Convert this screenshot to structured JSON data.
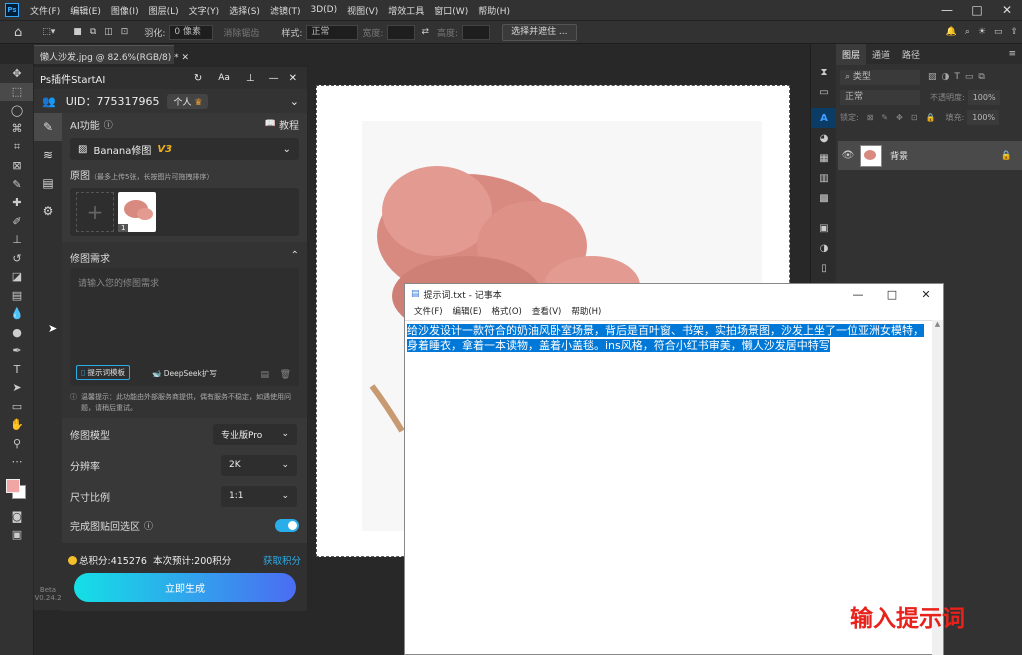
{
  "menubar": {
    "items": [
      "文件(F)",
      "编辑(E)",
      "图像(I)",
      "图层(L)",
      "文字(Y)",
      "选择(S)",
      "滤镜(T)",
      "3D(D)",
      "视图(V)",
      "增效工具",
      "窗口(W)",
      "帮助(H)"
    ]
  },
  "options": {
    "feather_label": "羽化:",
    "feather_value": "0 像素",
    "antialias": "消除锯齿",
    "style_label": "样式:",
    "style_value": "正常",
    "width_label": "宽度:",
    "height_label": "高度:",
    "select_mask": "选择并遮住 ..."
  },
  "document": {
    "tab": "懒人沙发.jpg @ 82.6%(RGB/8) *"
  },
  "plugin": {
    "title": "Ps插件StartAI",
    "uid": "UID：775317965",
    "account": "个人",
    "ai_label": "AI功能",
    "tutorial": "教程",
    "model_select": "Banana修图",
    "version": "V3",
    "source_label": "原图",
    "source_hint": "（最多上传5张，长按图片可拖拽排序）",
    "thumb_index": "1",
    "req_label": "修图需求",
    "req_placeholder": "请输入您的修图需求",
    "prompt_template": "提示词模板",
    "deepseek": "DeepSeek扩写",
    "notice": "温馨提示：此功能由外部服务商提供，偶有服务不稳定，如遇使用问题，请稍后重试。",
    "model_label": "修图模型",
    "model_value": "专业版Pro",
    "res_label": "分辨率",
    "res_value": "2K",
    "ratio_label": "尺寸比例",
    "ratio_value": "1:1",
    "paste_label": "完成图贴回选区",
    "points": "总积分:415276",
    "estimate": "本次预计:200积分",
    "get_points": "获取积分",
    "generate": "立即生成",
    "beta": "Beta",
    "ver": "V0.24.2"
  },
  "notepad": {
    "title": "提示词.txt - 记事本",
    "menu": [
      "文件(F)",
      "编辑(E)",
      "格式(O)",
      "查看(V)",
      "帮助(H)"
    ],
    "text": "给沙发设计一款符合的奶油风卧室场景，背后是百叶窗、书架，实拍场景图，沙发上坐了一位亚洲女模特，身着睡衣，拿着一本读物，盖着小盖毯。ins风格，符合小红书审美，懒人沙发居中特写"
  },
  "layers": {
    "tabs": [
      "图层",
      "通道",
      "路径"
    ],
    "search": "类型",
    "blend": "正常",
    "opacity_label": "不透明度:",
    "opacity": "100%",
    "lock_label": "锁定:",
    "fill_label": "填充:",
    "fill": "100%",
    "layer_name": "背景"
  },
  "overlay": {
    "caption": "输入提示词"
  },
  "colors": {
    "accent": "#2aaeea",
    "caption": "#e8221b",
    "selection": "#0078d7"
  }
}
